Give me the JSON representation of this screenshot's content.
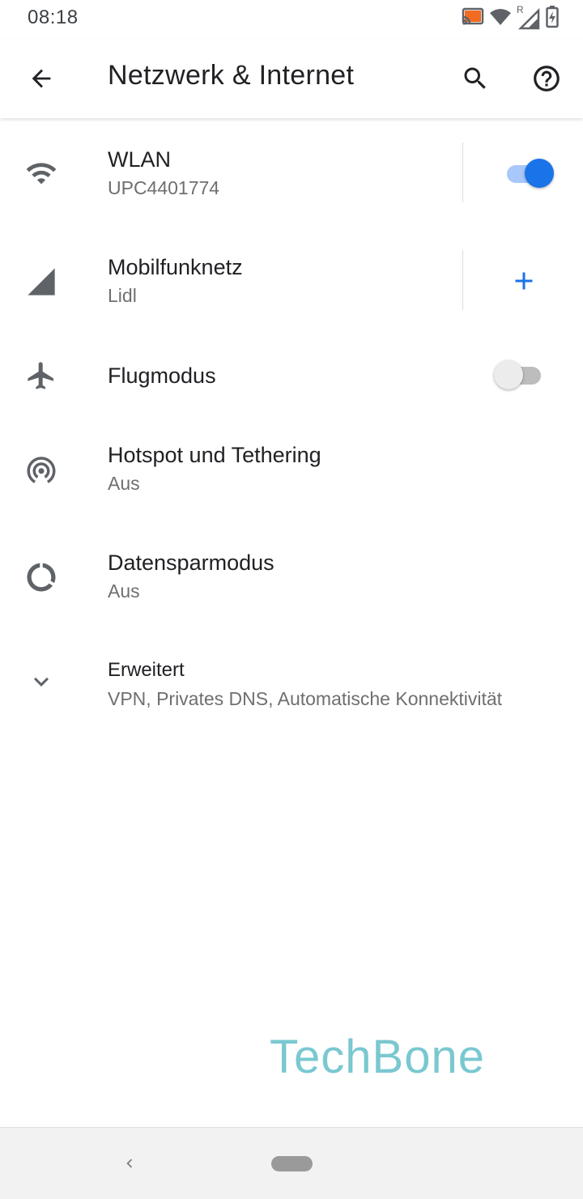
{
  "status_bar": {
    "time": "08:18",
    "roaming_indicator": "R",
    "icons": [
      "cast-icon",
      "wifi-icon",
      "cell-signal-icon",
      "battery-charging-icon"
    ]
  },
  "app_bar": {
    "title": "Netzwerk & Internet",
    "back_icon": "arrow-back-icon",
    "search_icon": "search-icon",
    "help_icon": "help-icon"
  },
  "settings": {
    "items": [
      {
        "id": "wlan",
        "title": "WLAN",
        "summary": "UPC4401774",
        "icon": "wifi-icon",
        "control": "toggle",
        "toggle_on": true
      },
      {
        "id": "mobilfunk",
        "title": "Mobilfunknetz",
        "summary": "Lidl",
        "icon": "cell-signal-icon",
        "control": "add-button"
      },
      {
        "id": "flugmodus",
        "title": "Flugmodus",
        "summary": "",
        "icon": "airplane-icon",
        "control": "toggle",
        "toggle_on": false
      },
      {
        "id": "hotspot",
        "title": "Hotspot und Tethering",
        "summary": "Aus",
        "icon": "hotspot-icon",
        "control": "none"
      },
      {
        "id": "datensparmodus",
        "title": "Datensparmodus",
        "summary": "Aus",
        "icon": "data-saver-icon",
        "control": "none"
      },
      {
        "id": "erweitert",
        "title": "Erweitert",
        "summary": "VPN, Privates DNS, Automatische Konnektivität",
        "icon": "chevron-down-icon",
        "control": "none"
      }
    ]
  },
  "watermark": "TechBone",
  "colors": {
    "accent": "#1a73e8",
    "toggle_track_on": "#a8c7fa",
    "toggle_track_off": "#bdbdbd",
    "toggle_thumb_off": "#ececec",
    "icon_gray": "#5f6368",
    "watermark": "#7ac8d0",
    "cast_orange": "#f26b21"
  },
  "navigation_bar": {
    "back_icon": "nav-back-icon",
    "home_icon": "nav-home-pill-icon"
  }
}
